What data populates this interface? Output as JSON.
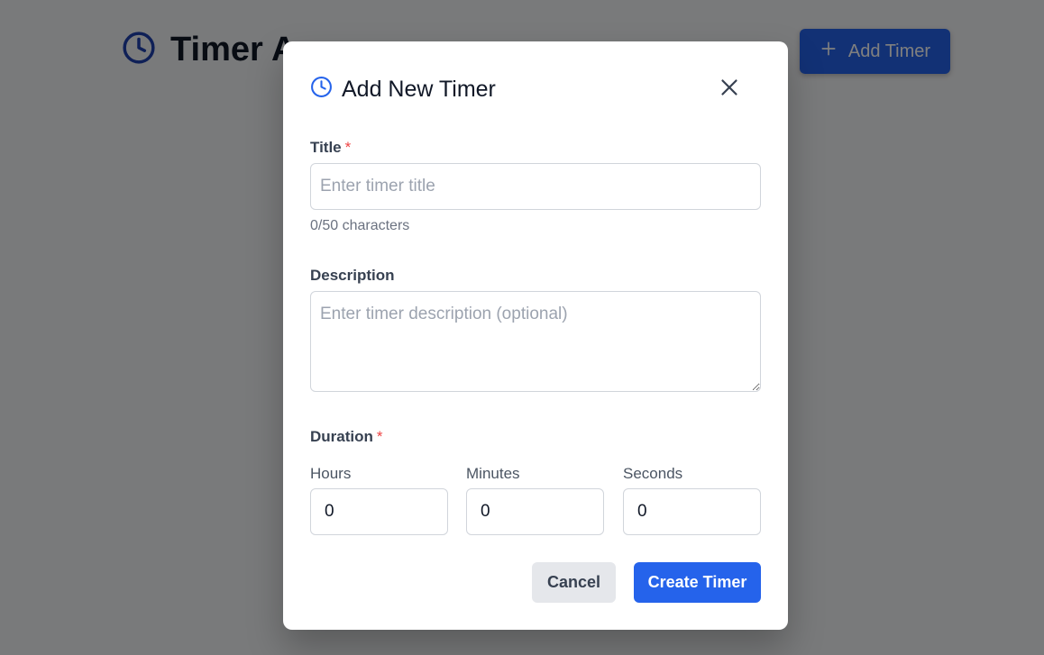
{
  "app": {
    "title": "Timer App",
    "add_timer_label": "Add Timer"
  },
  "modal": {
    "title": "Add New Timer",
    "title_field": {
      "label": "Title",
      "required_mark": "*",
      "placeholder": "Enter timer title",
      "value": "",
      "char_count": "0/50 characters"
    },
    "description_field": {
      "label": "Description",
      "placeholder": "Enter timer description (optional)",
      "value": ""
    },
    "duration": {
      "label": "Duration",
      "required_mark": "*",
      "hours_label": "Hours",
      "hours_value": "0",
      "minutes_label": "Minutes",
      "minutes_value": "0",
      "seconds_label": "Seconds",
      "seconds_value": "0"
    },
    "cancel_label": "Cancel",
    "create_label": "Create Timer"
  },
  "colors": {
    "accent": "#2563eb",
    "required": "#ef4444",
    "overlay": "rgba(0,0,0,0.5)"
  },
  "icons": {
    "app_title_icon": "clock-icon",
    "add_button_icon": "plus-icon",
    "modal_title_icon": "clock-icon",
    "close_icon": "close-icon"
  }
}
